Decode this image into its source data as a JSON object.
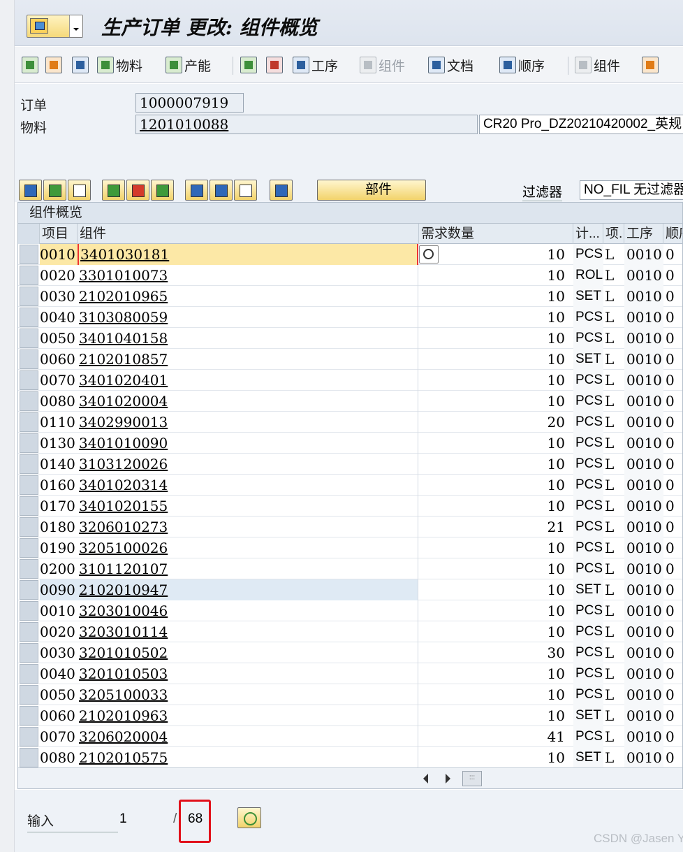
{
  "window": {
    "title": "生产订单 更改: 组件概览"
  },
  "toolbar": {
    "material": "物料",
    "capacity": "产能",
    "operation": "工序",
    "component": "组件",
    "document": "文档",
    "sequence": "顺序",
    "component2": "组件"
  },
  "header": {
    "order_label": "订单",
    "order_value": "1000007919",
    "material_label": "物料",
    "material_value": "1201010088",
    "material_desc": "CR20 Pro_DZ20210420002_英规"
  },
  "grid_toolbar": {
    "parts_label": "部件",
    "filter_label": "过滤器",
    "filter_value": "NO_FIL 无过滤器"
  },
  "grid": {
    "title": "组件概览",
    "columns": [
      "项目",
      "组件",
      "需求数量",
      "计...",
      "项.",
      "工序",
      "顺序"
    ],
    "rows": [
      {
        "item": "0010",
        "component": "3401030181",
        "qty": "10",
        "unit": "PCS",
        "cat": "L",
        "op": "0010",
        "seq": "0"
      },
      {
        "item": "0020",
        "component": "3301010073",
        "qty": "10",
        "unit": "ROL",
        "cat": "L",
        "op": "0010",
        "seq": "0"
      },
      {
        "item": "0030",
        "component": "2102010965",
        "qty": "10",
        "unit": "SET",
        "cat": "L",
        "op": "0010",
        "seq": "0"
      },
      {
        "item": "0040",
        "component": "3103080059",
        "qty": "10",
        "unit": "PCS",
        "cat": "L",
        "op": "0010",
        "seq": "0"
      },
      {
        "item": "0050",
        "component": "3401040158",
        "qty": "10",
        "unit": "PCS",
        "cat": "L",
        "op": "0010",
        "seq": "0"
      },
      {
        "item": "0060",
        "component": "2102010857",
        "qty": "10",
        "unit": "SET",
        "cat": "L",
        "op": "0010",
        "seq": "0"
      },
      {
        "item": "0070",
        "component": "3401020401",
        "qty": "10",
        "unit": "PCS",
        "cat": "L",
        "op": "0010",
        "seq": "0"
      },
      {
        "item": "0080",
        "component": "3401020004",
        "qty": "10",
        "unit": "PCS",
        "cat": "L",
        "op": "0010",
        "seq": "0"
      },
      {
        "item": "0110",
        "component": "3402990013",
        "qty": "20",
        "unit": "PCS",
        "cat": "L",
        "op": "0010",
        "seq": "0"
      },
      {
        "item": "0130",
        "component": "3401010090",
        "qty": "10",
        "unit": "PCS",
        "cat": "L",
        "op": "0010",
        "seq": "0"
      },
      {
        "item": "0140",
        "component": "3103120026",
        "qty": "10",
        "unit": "PCS",
        "cat": "L",
        "op": "0010",
        "seq": "0"
      },
      {
        "item": "0160",
        "component": "3401020314",
        "qty": "10",
        "unit": "PCS",
        "cat": "L",
        "op": "0010",
        "seq": "0"
      },
      {
        "item": "0170",
        "component": "3401020155",
        "qty": "10",
        "unit": "PCS",
        "cat": "L",
        "op": "0010",
        "seq": "0"
      },
      {
        "item": "0180",
        "component": "3206010273",
        "qty": "21",
        "unit": "PCS",
        "cat": "L",
        "op": "0010",
        "seq": "0"
      },
      {
        "item": "0190",
        "component": "3205100026",
        "qty": "10",
        "unit": "PCS",
        "cat": "L",
        "op": "0010",
        "seq": "0"
      },
      {
        "item": "0200",
        "component": "3101120107",
        "qty": "10",
        "unit": "PCS",
        "cat": "L",
        "op": "0010",
        "seq": "0"
      },
      {
        "item": "0090",
        "component": "2102010947",
        "qty": "10",
        "unit": "SET",
        "cat": "L",
        "op": "0010",
        "seq": "0"
      },
      {
        "item": "0010",
        "component": "3203010046",
        "qty": "10",
        "unit": "PCS",
        "cat": "L",
        "op": "0010",
        "seq": "0"
      },
      {
        "item": "0020",
        "component": "3203010114",
        "qty": "10",
        "unit": "PCS",
        "cat": "L",
        "op": "0010",
        "seq": "0"
      },
      {
        "item": "0030",
        "component": "3201010502",
        "qty": "30",
        "unit": "PCS",
        "cat": "L",
        "op": "0010",
        "seq": "0"
      },
      {
        "item": "0040",
        "component": "3201010503",
        "qty": "10",
        "unit": "PCS",
        "cat": "L",
        "op": "0010",
        "seq": "0"
      },
      {
        "item": "0050",
        "component": "3205100033",
        "qty": "10",
        "unit": "PCS",
        "cat": "L",
        "op": "0010",
        "seq": "0"
      },
      {
        "item": "0060",
        "component": "2102010963",
        "qty": "10",
        "unit": "SET",
        "cat": "L",
        "op": "0010",
        "seq": "0"
      },
      {
        "item": "0070",
        "component": "3206020004",
        "qty": "41",
        "unit": "PCS",
        "cat": "L",
        "op": "0010",
        "seq": "0"
      },
      {
        "item": "0080",
        "component": "2102010575",
        "qty": "10",
        "unit": "SET",
        "cat": "L",
        "op": "0010",
        "seq": "0"
      }
    ]
  },
  "footer": {
    "entry_label": "输入",
    "current": "1",
    "separator": "/",
    "total": "68"
  },
  "watermark": "CSDN @Jasen Ye"
}
